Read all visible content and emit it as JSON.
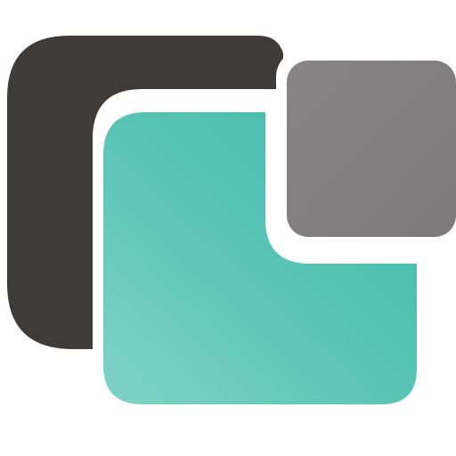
{
  "icon": {
    "name": "app-logo-icon",
    "description_free": true,
    "colors": {
      "background": "#ffffff",
      "dark_shape": "#3e3b3b",
      "gray_square": "#878586",
      "gray_square_edge": "#7b797a",
      "teal_light": "#7fd3c6",
      "teal_mid": "#5cc5b7",
      "teal_dark": "#3ebaa9",
      "separator": "#ffffff"
    }
  }
}
